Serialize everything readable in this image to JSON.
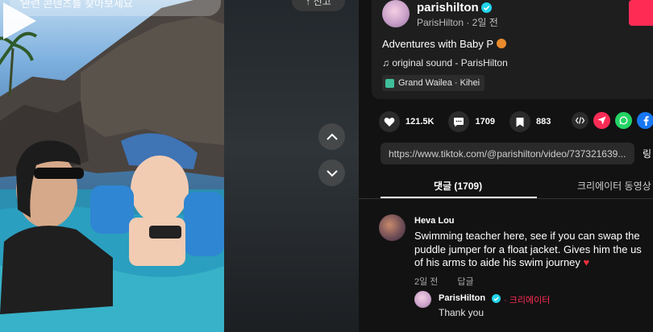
{
  "colors": {
    "accent": "#fe2c55",
    "verified": "#20d5ec",
    "panel_bg": "#121212",
    "card_bg": "#1e1e1e",
    "heart": "#e8303d"
  },
  "video": {
    "search_placeholder": "관련 콘텐츠를 찾아보세요",
    "top_pill_label": "↑ 신고",
    "icons": [
      "search-icon",
      "play-icon",
      "chevron-up-icon",
      "chevron-down-icon"
    ]
  },
  "post": {
    "author_name": "parishilton",
    "author_sub": "ParisHilton · 2일 전",
    "caption": "Adventures with Baby P",
    "sound": "original sound - ParisHilton",
    "location": "Grand Wailea · Kihei"
  },
  "stats": {
    "likes": "121.5K",
    "comments": "1709",
    "saves": "883"
  },
  "share_icons": [
    "embed-icon",
    "send-icon",
    "whatsapp-icon",
    "facebook-icon"
  ],
  "link": {
    "url": "https://www.tiktok.com/@parishilton/video/737321639...",
    "copy_label": "링"
  },
  "tabs": {
    "comments_label": "댓글 (1709)",
    "creator_label": "크리에이터 동영상"
  },
  "comment": {
    "author": "Heva Lou",
    "line1": "Swimming teacher here, see if you can swap the",
    "line2": "puddle jumper for a float jacket. Gives him the us",
    "line3": "of his arms to aide his swim journey",
    "heart": "♥",
    "time": "2일 전",
    "reply_label": "답글"
  },
  "reply": {
    "author": "ParisHilton",
    "badge": "· 크리에이터",
    "text": "Thank you"
  }
}
